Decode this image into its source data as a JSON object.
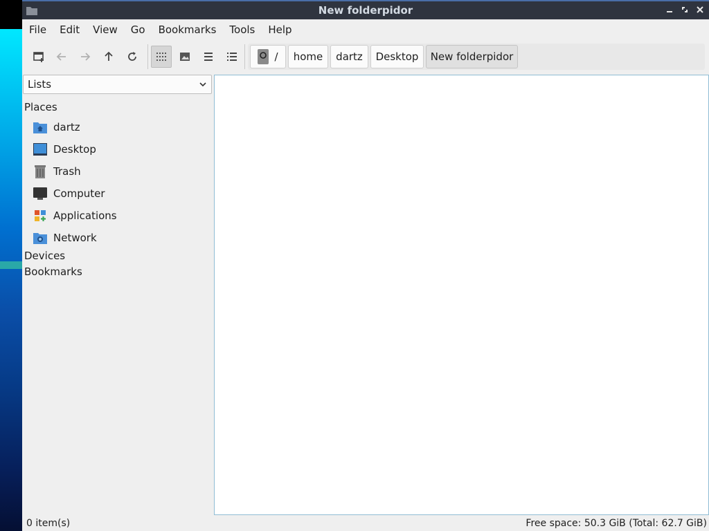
{
  "window": {
    "title": "New folderpidor"
  },
  "menu": [
    "File",
    "Edit",
    "View",
    "Go",
    "Bookmarks",
    "Tools",
    "Help"
  ],
  "breadcrumb": {
    "root": "/",
    "items": [
      "home",
      "dartz",
      "Desktop",
      "New folderpidor"
    ]
  },
  "sidebar": {
    "select": "Lists",
    "places_heading": "Places",
    "places": [
      {
        "label": "dartz",
        "icon": "home-folder-icon"
      },
      {
        "label": "Desktop",
        "icon": "desktop-icon"
      },
      {
        "label": "Trash",
        "icon": "trash-icon"
      },
      {
        "label": "Computer",
        "icon": "computer-icon"
      },
      {
        "label": "Applications",
        "icon": "applications-icon"
      },
      {
        "label": "Network",
        "icon": "network-icon"
      }
    ],
    "devices_heading": "Devices",
    "bookmarks_heading": "Bookmarks"
  },
  "status": {
    "items": "0 item(s)",
    "free_space": "Free space: 50.3 GiB (Total: 62.7 GiB)"
  },
  "colors": {
    "titlebar": "#2f343f",
    "content_border": "#8fbcd4",
    "folder": "#4a90d9"
  }
}
